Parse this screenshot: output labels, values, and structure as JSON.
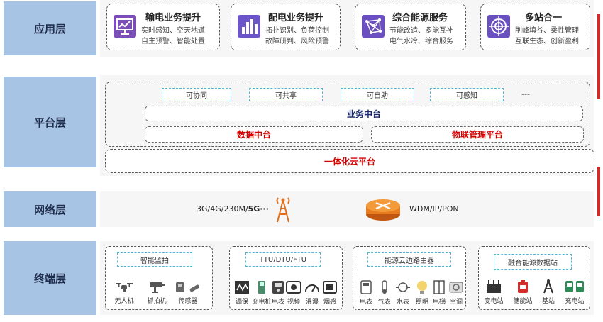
{
  "layers": {
    "app": "应用层",
    "platform": "平台层",
    "network": "网络层",
    "terminal": "终端层"
  },
  "apps": [
    {
      "title": "输电业务提升",
      "line1": "实时感知、空天地道",
      "line2": "自主预警、智能处置",
      "icon": "monitor-chart-icon",
      "color": "#7b4fb5"
    },
    {
      "title": "配电业务提升",
      "line1": "拓扑识别、负荷控制",
      "line2": "故障研判、风险预警",
      "icon": "bar-chart-icon",
      "color": "#6b55c9"
    },
    {
      "title": "综合能源服务",
      "line1": "节能改造、多能互补",
      "line2": "电气水冷、综合服务",
      "icon": "network-graph-icon",
      "color": "#6b4fc0"
    },
    {
      "title": "多站合一",
      "line1": "削峰填谷、柔性管理",
      "line2": "互联生态、创新盈利",
      "icon": "target-icon",
      "color": "#6a50bf"
    }
  ],
  "platform": {
    "tags": [
      "可协同",
      "可共享",
      "可自助",
      "可感知"
    ],
    "ellipsis": "---",
    "business": "业务中台",
    "data": "数据中台",
    "iot": "物联管理平台",
    "cloud": "一体化云平台"
  },
  "network": {
    "left_text": "3G/4G/230M/",
    "left_bold": "5G···",
    "right_text": "WDM/IP/PON",
    "tower_icon": "signal-tower-icon",
    "router_icon": "router-icon"
  },
  "terminals": [
    {
      "label": "智能监拍",
      "devices": [
        {
          "name": "无人机",
          "icon": "drone-icon"
        },
        {
          "name": "抓拍机",
          "icon": "camera-icon"
        },
        {
          "name": "传感器",
          "icon": "sensor-icon"
        }
      ]
    },
    {
      "label": "TTU/DTU/FTU",
      "devices": [
        {
          "name": "漏保",
          "icon": "leakage-protector-icon"
        },
        {
          "name": "充电桩",
          "icon": "charging-pile-icon"
        },
        {
          "name": "电表",
          "icon": "meter-icon"
        },
        {
          "name": "视频",
          "icon": "video-icon"
        },
        {
          "name": "温湿",
          "icon": "gauge-icon"
        },
        {
          "name": "烟感",
          "icon": "smoke-detector-icon"
        }
      ]
    },
    {
      "label": "能源云边路由器",
      "devices": [
        {
          "name": "电表",
          "icon": "electric-meter-icon"
        },
        {
          "name": "气表",
          "icon": "gas-meter-icon"
        },
        {
          "name": "水表",
          "icon": "water-meter-icon"
        },
        {
          "name": "照明",
          "icon": "bulb-icon"
        },
        {
          "name": "电梯",
          "icon": "elevator-icon"
        },
        {
          "name": "空调",
          "icon": "air-conditioner-icon"
        }
      ]
    },
    {
      "label": "融合能源数据站",
      "devices": [
        {
          "name": "变电站",
          "icon": "substation-icon"
        },
        {
          "name": "储能站",
          "icon": "battery-icon"
        },
        {
          "name": "基站",
          "icon": "base-station-icon"
        },
        {
          "name": "充电站",
          "icon": "charging-station-icon"
        }
      ]
    }
  ]
}
